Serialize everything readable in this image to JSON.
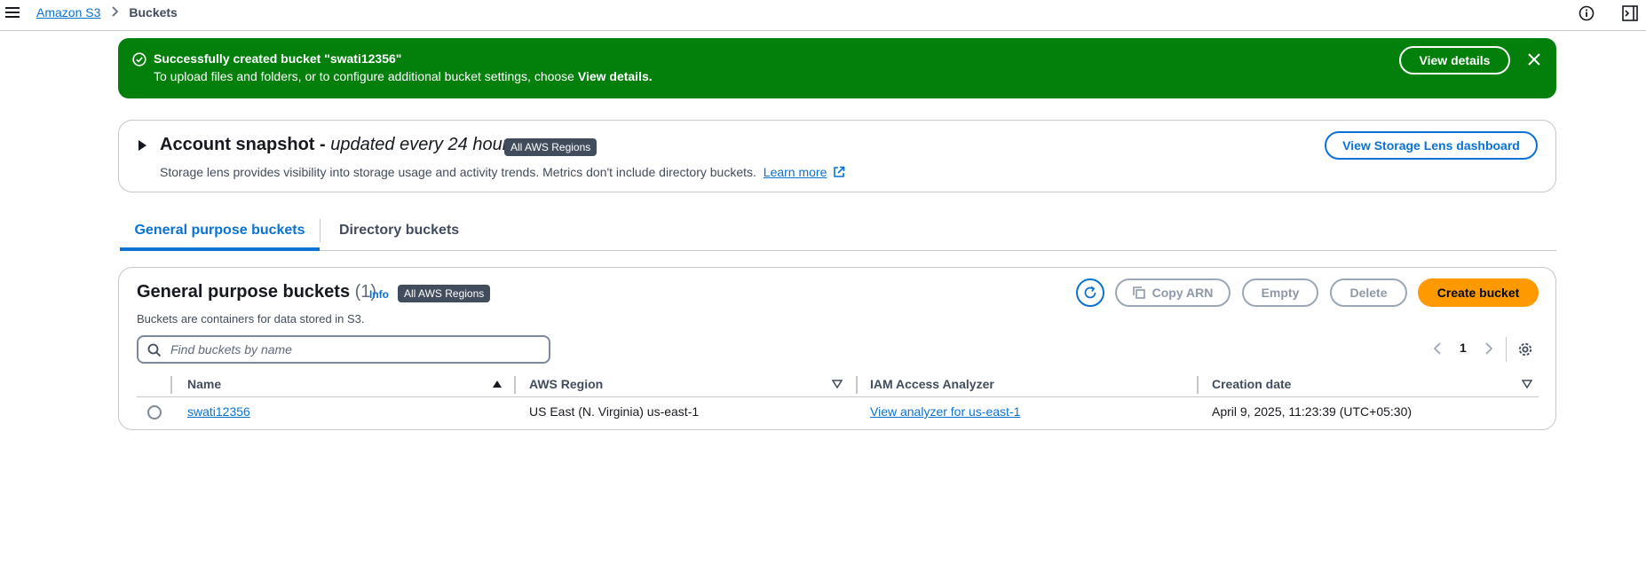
{
  "breadcrumb": {
    "root": "Amazon S3",
    "current": "Buckets"
  },
  "flash": {
    "title": "Successfully created bucket \"swati12356\"",
    "body_text": "To upload files and folders, or to configure additional bucket settings, choose",
    "body_bold": "View details.",
    "button": "View details",
    "color": "#037f0c"
  },
  "snapshot": {
    "title": "Account snapshot - ",
    "title_italic": "updated every 24 hours",
    "badge": "All AWS Regions",
    "description": "Storage lens provides visibility into storage usage and activity trends. Metrics don't include directory buckets.",
    "learn_more": "Learn more",
    "button": "View Storage Lens dashboard"
  },
  "tabs": [
    {
      "label": "General purpose buckets",
      "active": true
    },
    {
      "label": "Directory buckets",
      "active": false
    }
  ],
  "panel": {
    "title": "General purpose buckets",
    "count": "(1)",
    "info": "Info",
    "badge": "All AWS Regions",
    "description": "Buckets are containers for data stored in S3.",
    "actions": {
      "copy_arn": "Copy ARN",
      "empty": "Empty",
      "delete": "Delete",
      "create": "Create bucket"
    },
    "search_placeholder": "Find buckets by name",
    "page": "1"
  },
  "table": {
    "columns": [
      "Name",
      "AWS Region",
      "IAM Access Analyzer",
      "Creation date"
    ],
    "rows": [
      {
        "name": "swati12356",
        "region": "US East (N. Virginia) us-east-1",
        "analyzer": "View analyzer for us-east-1",
        "created": "April 9, 2025, 11:23:39 (UTC+05:30)"
      }
    ]
  },
  "colors": {
    "accent": "#0972d3",
    "primary_button": "#ff9900",
    "success": "#037f0c",
    "badge": "#414d5c"
  },
  "icons": [
    "menu-icon",
    "chevron-right-icon",
    "info-icon",
    "side-panel-icon",
    "success-check-icon",
    "close-icon",
    "caret-right-icon",
    "external-link-icon",
    "refresh-icon",
    "copy-icon",
    "search-icon",
    "chevron-left-icon",
    "settings-icon",
    "sort-ascending-icon",
    "sort-icon"
  ]
}
